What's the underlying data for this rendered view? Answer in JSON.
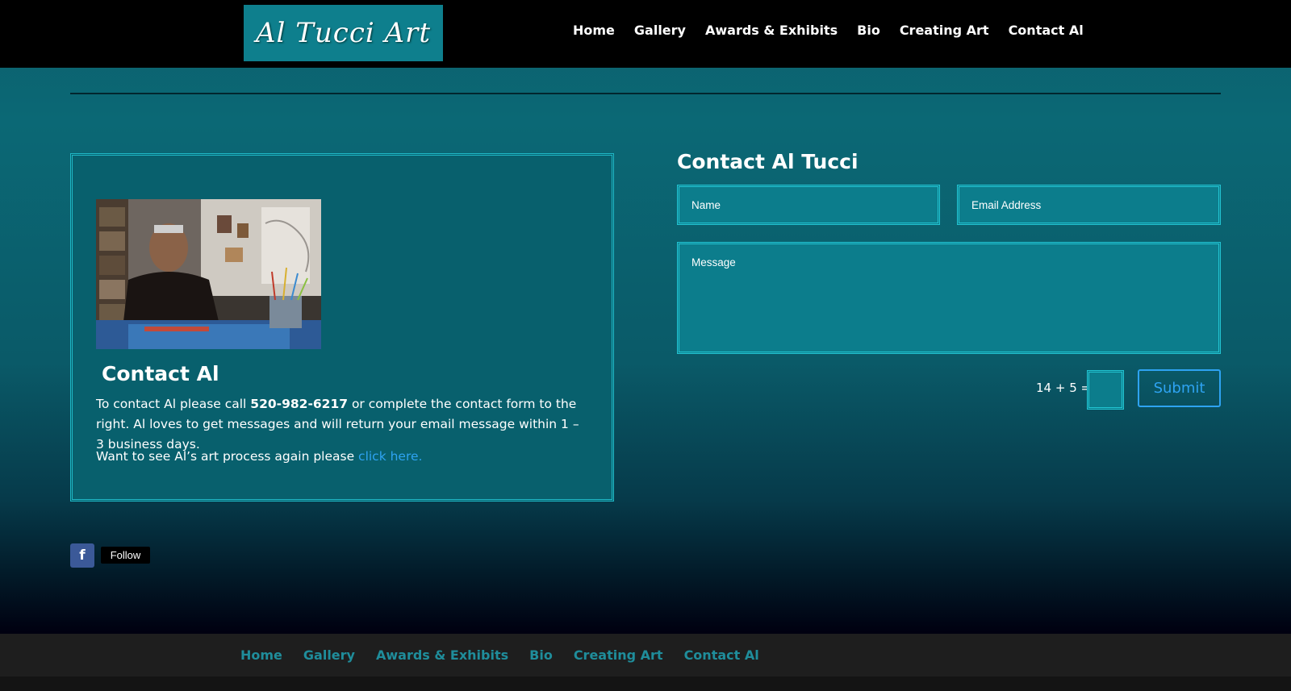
{
  "header": {
    "logo_text": "Al Tucci Art",
    "nav": [
      "Home",
      "Gallery",
      "Awards & Exhibits",
      "Bio",
      "Creating Art",
      "Contact Al"
    ]
  },
  "contact_box": {
    "title": "Contact Al",
    "text_before_phone": "To contact Al please call ",
    "phone": "520-982-6217",
    "text_after_phone": " or complete the contact form to the right.  Al loves to get messages and will return your email message within 1 – 3 business days.",
    "process_text": "Want to see Al’s art process again please ",
    "process_link": "click here."
  },
  "form": {
    "title": "Contact Al Tucci",
    "name_placeholder": "Name",
    "email_placeholder": "Email Address",
    "message_placeholder": "Message",
    "captcha_label": "14 + 5 =",
    "submit_label": "Submit"
  },
  "social": {
    "facebook_glyph": "f",
    "follow_label": "Follow"
  },
  "footer": {
    "nav": [
      "Home",
      "Gallery",
      "Awards & Exhibits",
      "Bio",
      "Creating Art",
      "Contact Al"
    ]
  },
  "colors": {
    "accent_teal": "#0e7f8d",
    "link_blue": "#2ea3f2",
    "footer_link": "#1f8d9b",
    "facebook_blue": "#3b5998"
  }
}
